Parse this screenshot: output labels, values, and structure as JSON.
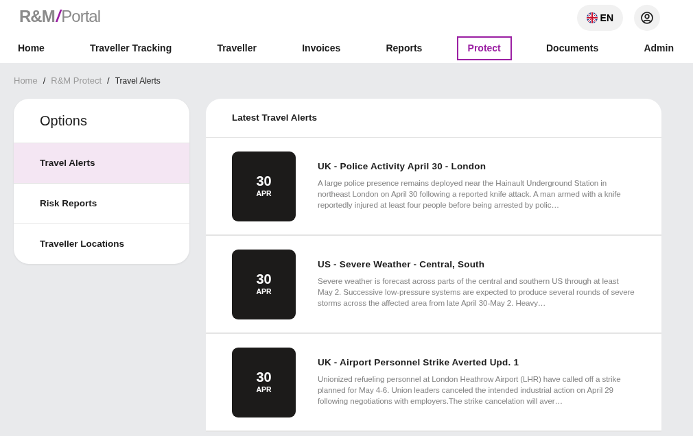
{
  "logo": {
    "brand": "R&M",
    "separator": "/",
    "product": "Portal"
  },
  "language": {
    "code": "EN"
  },
  "nav": [
    {
      "label": "Home",
      "selected": false
    },
    {
      "label": "Traveller Tracking",
      "selected": false
    },
    {
      "label": "Traveller",
      "selected": false
    },
    {
      "label": "Invoices",
      "selected": false
    },
    {
      "label": "Reports",
      "selected": false
    },
    {
      "label": "Protect",
      "selected": true
    },
    {
      "label": "Documents",
      "selected": false
    },
    {
      "label": "Admin",
      "selected": false
    }
  ],
  "breadcrumb": [
    {
      "label": "Home",
      "kind": "link"
    },
    {
      "label": "/",
      "kind": "separator"
    },
    {
      "label": "R&M Protect",
      "kind": "link"
    },
    {
      "label": "/",
      "kind": "separator"
    },
    {
      "label": "Travel Alerts",
      "kind": "current"
    }
  ],
  "sidebar": {
    "title": "Options",
    "items": [
      {
        "label": "Travel Alerts",
        "selected": true
      },
      {
        "label": "Risk Reports",
        "selected": false
      },
      {
        "label": "Traveller Locations",
        "selected": false
      }
    ]
  },
  "alerts": {
    "title": "Latest Travel Alerts",
    "items": [
      {
        "day": "30",
        "month": "APR",
        "title": "UK - Police Activity April 30 - London",
        "description": "A large police presence remains deployed near the Hainault Underground Station in northeast London on April 30 following a reported knife attack. A man armed with a knife reportedly injured at least four people before being arrested by polic…"
      },
      {
        "day": "30",
        "month": "APR",
        "title": "US - Severe Weather - Central, South",
        "description": "Severe weather is forecast across parts of the central and southern US through at least May 2. Successive low-pressure systems are expected to produce several rounds of severe storms across the affected area from late April 30-May 2. Heavy…"
      },
      {
        "day": "30",
        "month": "APR",
        "title": "UK - Airport Personnel Strike Averted Upd. 1",
        "description": "Unionized refueling personnel at London Heathrow Airport (LHR) have called off a strike planned for May 4-6. Union leaders canceled the intended industrial action on April 29 following negotiations with employers.The strike cancelation will aver…"
      }
    ]
  }
}
